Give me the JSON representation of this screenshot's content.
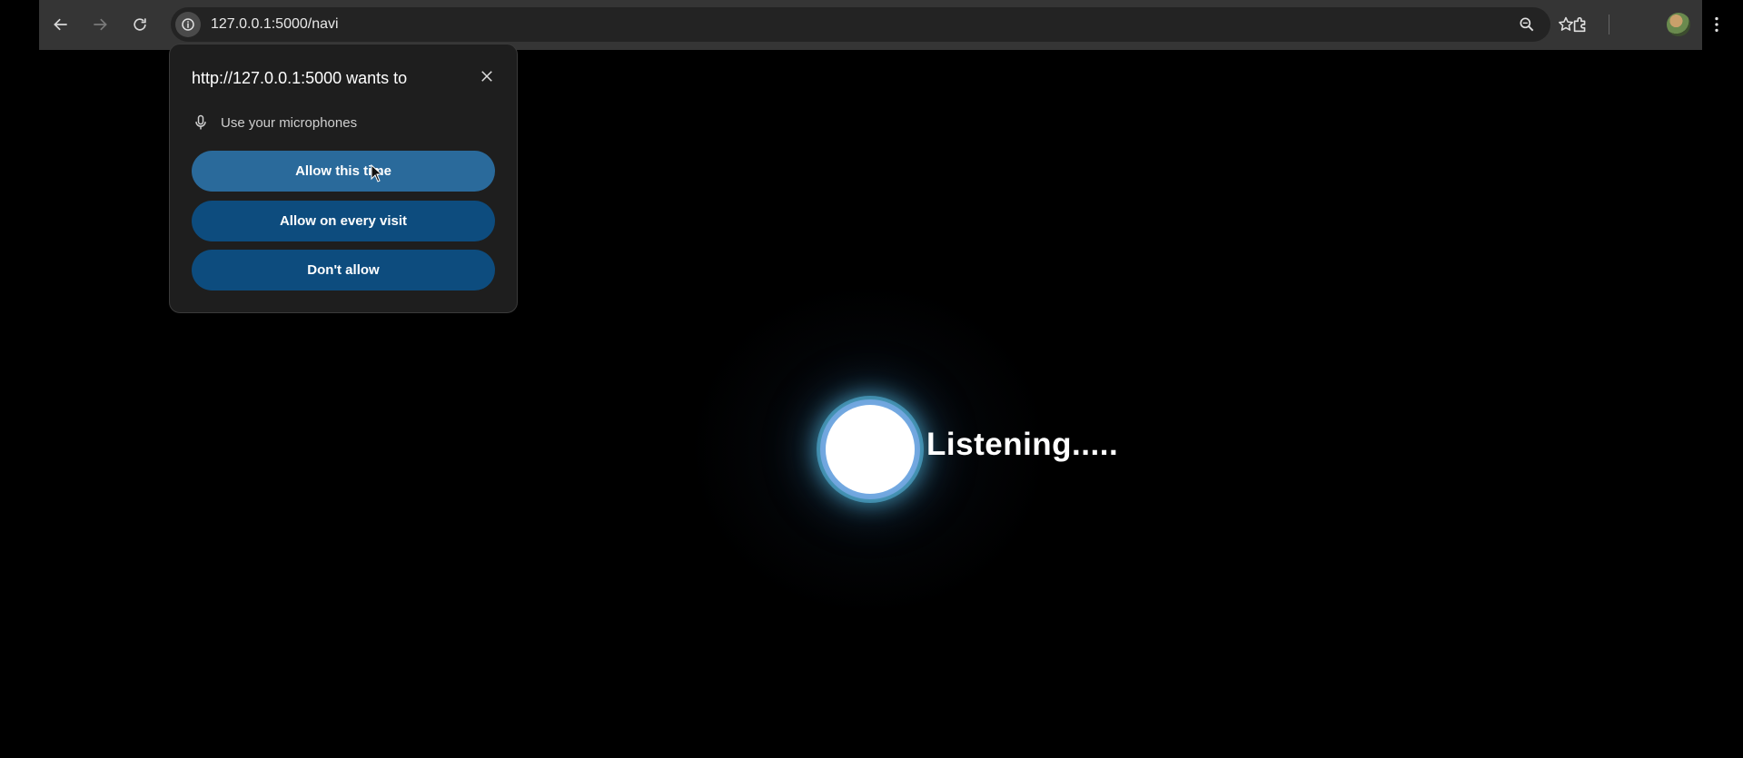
{
  "browser": {
    "url": "127.0.0.1:5000/navi",
    "icons": {
      "back": "arrow-left-icon",
      "forward": "arrow-right-icon",
      "reload": "reload-icon",
      "site_info": "info-icon",
      "zoom": "magnifier-icon",
      "bookmark": "star-icon",
      "extensions": "puzzle-icon",
      "profile": "avatar",
      "menu": "kebab-menu-icon"
    }
  },
  "permission_popup": {
    "title": "http://127.0.0.1:5000 wants to",
    "permission": "Use your microphones",
    "buttons": {
      "allow_once": "Allow this time",
      "allow_always": "Allow on every visit",
      "deny": "Don't allow"
    }
  },
  "page": {
    "status_text": "Listening.....",
    "colors": {
      "background": "#000000",
      "orb": "#ffffff",
      "orb_glow": "#5ac8f0",
      "button_primary": "#0d4c7e",
      "button_hover": "#2a6a9b"
    }
  }
}
